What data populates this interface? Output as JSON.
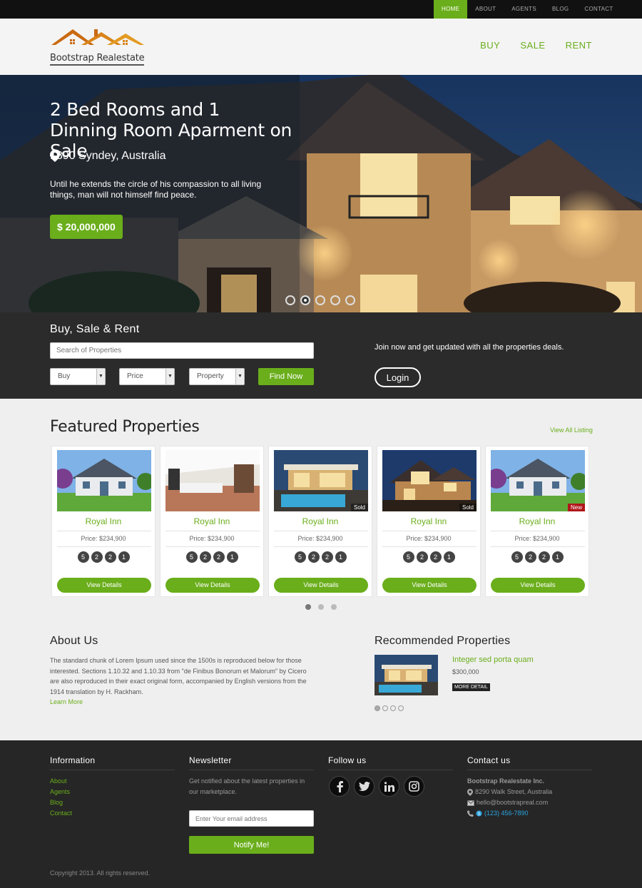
{
  "topnav": [
    "HOME",
    "ABOUT",
    "AGENTS",
    "BLOG",
    "CONTACT"
  ],
  "brand": {
    "name": "Bootstrap Realestate",
    "accent": "#6aae1b"
  },
  "mainnav": [
    "BUY",
    "SALE",
    "RENT"
  ],
  "hero": {
    "title": "2 Bed Rooms and 1 Dinning Room Aparment on Sale",
    "location": "1890 Syndey, Australia",
    "description": "Until he extends the circle of his compassion to all living things, man will not himself find peace.",
    "price": "$ 20,000,000",
    "active_slide": 2
  },
  "search": {
    "title": "Buy, Sale & Rent",
    "placeholder": "Search of Properties",
    "selects": [
      "Buy",
      "Price",
      "Property"
    ],
    "button": "Find Now",
    "join_text": "Join now and get updated with all the properties deals.",
    "login": "Login"
  },
  "featured": {
    "title": "Featured Properties",
    "view_all": "View All Listing",
    "cards": [
      {
        "name": "Royal Inn",
        "price": "Price: $234,900",
        "features": [
          "5",
          "2",
          "2",
          "1"
        ],
        "button": "View Details",
        "badge": "",
        "image": "house-green-lawn"
      },
      {
        "name": "Royal Inn",
        "price": "Price: $234,900",
        "features": [
          "5",
          "2",
          "2",
          "1"
        ],
        "button": "View Details",
        "badge": "",
        "image": "modern-interior"
      },
      {
        "name": "Royal Inn",
        "price": "Price: $234,900",
        "features": [
          "5",
          "2",
          "2",
          "1"
        ],
        "button": "View Details",
        "badge": "Sold",
        "image": "pool-night"
      },
      {
        "name": "Royal Inn",
        "price": "Price: $234,900",
        "features": [
          "5",
          "2",
          "2",
          "1"
        ],
        "button": "View Details",
        "badge": "Sold",
        "image": "house-night"
      },
      {
        "name": "Royal Inn",
        "price": "Price: $234,900",
        "features": [
          "5",
          "2",
          "2",
          "1"
        ],
        "button": "View Details",
        "badge": "New",
        "image": "house-green-lawn"
      }
    ]
  },
  "about": {
    "title": "About Us",
    "text": "The standard chunk of Lorem Ipsum used since the 1500s is reproduced below for those interested. Sections 1.10.32 and 1.10.33 from \"de Finibus Bonorum et Malorum\" by Cicero are also reproduced in their exact original form, accompanied by English versions from the 1914 translation by H. Rackham.",
    "link": "Learn More"
  },
  "recommended": {
    "title": "Recommended Properties",
    "name": "Integer sed porta quam",
    "price": "$300,000",
    "button": "MORE DETAIL"
  },
  "footer": {
    "information": {
      "title": "Information",
      "links": [
        "About",
        "Agents",
        "Blog",
        "Contact"
      ]
    },
    "newsletter": {
      "title": "Newsletter",
      "text": "Get notified about the latest properties in our marketplace.",
      "placeholder": "Enter Your email address",
      "button": "Notify Me!"
    },
    "follow": {
      "title": "Follow us",
      "icons": [
        "facebook-icon",
        "twitter-icon",
        "linkedin-icon",
        "instagram-icon"
      ]
    },
    "contact": {
      "title": "Contact us",
      "company": "Bootstrap Realestate Inc.",
      "address": "8290 Walk Street, Australia",
      "email": "hello@bootstrapreal.com",
      "phone": "(123) 456-7890"
    },
    "copyright": "Copyright 2013. All rights reserved."
  }
}
